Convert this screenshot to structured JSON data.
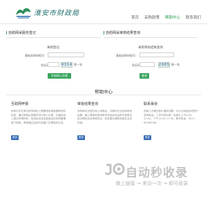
{
  "header": {
    "logo_text": "淮安市财政局",
    "nav": [
      "首页",
      "采购政策",
      "帮助中心",
      "联系我们"
    ],
    "active_nav": 2
  },
  "panels": [
    {
      "title": "自助网采服务登记",
      "sub_title": "采购登记",
      "field1_label": "基础采购申报号：",
      "field2_label": "验证码：",
      "captcha": "9314",
      "refresh": "换一张",
      "submit": "开始网上办理"
    },
    {
      "title": "自助网采审核结果查询",
      "sub_title": "采购审核结果查询",
      "field1_label": "基础采购申报号：",
      "field2_label": "验证码：",
      "captcha": "2905",
      "refresh": "换一张",
      "submit": "查询"
    }
  ],
  "help": {
    "title": "帮助中心",
    "columns": [
      {
        "title": "互助网申报",
        "body": "网申办件在单位财务网站上需要提前填报基础采购信息，通过审核后按要求进行网上办理，并通过网上提交申请材料，系统自动将信息推送至采购管理部门审核，审核通过后即可到窗口办理相关业务。",
        "button": "更多"
      },
      {
        "title": "审批结果查询",
        "body": "采购单位在提交网上申报后，可随时在此查询审批结果，输入基础采购申报号及验证码后即可查看当前办理状态及审核意见，如有疑问请联系相关业务科室。",
        "button": "更多"
      },
      {
        "title": "联系渠道",
        "body": "如网上办理过程中遇到问题，可以在线留言或拨打咨询电话，工作时间为周一至周五上午8:30-12:00，下午14:30-17:30，联系电话：0517-83168166。",
        "button": "更多"
      }
    ]
  },
  "watermark": {
    "text": "自动秒收录",
    "sub": "做上链接 → 来访一次 → 即可收录"
  },
  "colors": {
    "brand_green": "#3aa55f",
    "link_blue": "#3a6fb5"
  }
}
